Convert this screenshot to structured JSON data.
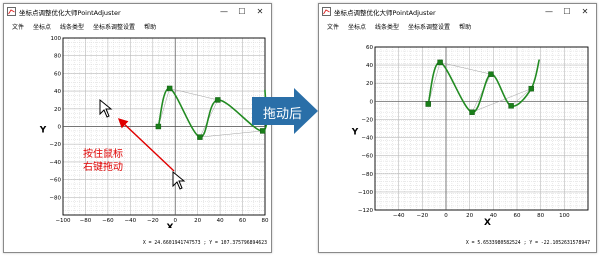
{
  "left_window": {
    "title": "坐标点调整优化大师PointAdjuster",
    "menu": [
      "文件",
      "坐标点",
      "线条类型",
      "坐标系调整设置",
      "帮助"
    ],
    "status": "X = 24.6601941747573 ; Y = 107.375796894623",
    "buttons": {
      "minimize": "—",
      "maximize": "☐",
      "close": "✕"
    }
  },
  "right_window": {
    "title": "坐标点调整优化大师PointAdjuster",
    "menu": [
      "文件",
      "坐标点",
      "线条类型",
      "坐标系调整设置",
      "帮助"
    ],
    "status": "X = 5.6533980582524 ; Y = -22.1052631578947",
    "buttons": {
      "minimize": "—",
      "maximize": "☐",
      "close": "✕"
    }
  },
  "annotation": {
    "text_line1": "按住鼠标",
    "text_line2": "右键拖动",
    "arrow_label": "拖动后",
    "arrow_color": "#e00000",
    "big_arrow_color": "#2a6fa8"
  },
  "chart_data": [
    {
      "type": "scatter",
      "xlabel": "X",
      "ylabel": "Y",
      "xlim": [
        -100,
        80
      ],
      "ylim": [
        -100,
        100
      ],
      "xticks": [
        -100,
        -80,
        -60,
        -40,
        -20,
        0,
        20,
        40,
        60,
        80
      ],
      "yticks": [
        -80,
        -60,
        -40,
        -20,
        0,
        20,
        40,
        60,
        80,
        100
      ],
      "grid": true,
      "points": [
        [
          -15,
          0
        ],
        [
          -5,
          43
        ],
        [
          38,
          30
        ],
        [
          22,
          -12
        ],
        [
          78,
          -5
        ]
      ],
      "curve_color": "#228b22",
      "point_color": "#1a7f1a"
    },
    {
      "type": "scatter",
      "xlabel": "X",
      "ylabel": "Y",
      "xlim": [
        -60,
        120
      ],
      "ylim": [
        -120,
        60
      ],
      "xticks": [
        -40,
        -20,
        0,
        20,
        40,
        60,
        80,
        100
      ],
      "yticks": [
        -120,
        -100,
        -80,
        -60,
        -40,
        -20,
        0,
        20,
        40,
        60
      ],
      "grid": true,
      "points": [
        [
          -15,
          -3
        ],
        [
          -5,
          43
        ],
        [
          38,
          30
        ],
        [
          22,
          -12
        ],
        [
          72,
          14
        ],
        [
          55,
          -5
        ]
      ],
      "curve_color": "#228b22",
      "point_color": "#1a7f1a"
    }
  ]
}
